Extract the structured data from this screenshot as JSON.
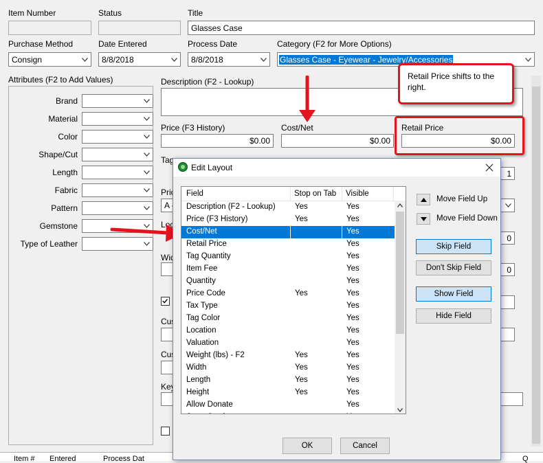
{
  "header_fields": {
    "item_number": {
      "label": "Item Number",
      "value": ""
    },
    "status": {
      "label": "Status",
      "value": ""
    },
    "title": {
      "label": "Title",
      "value": "Glasses Case"
    },
    "purchase_method": {
      "label": "Purchase Method",
      "value": "Consign"
    },
    "date_entered": {
      "label": "Date Entered",
      "value": "8/8/2018"
    },
    "process_date": {
      "label": "Process Date",
      "value": "8/8/2018"
    },
    "category": {
      "label": "Category (F2 for More Options)",
      "value": "Glasses Case - Eyewear - Jewelry/Accessories"
    }
  },
  "attributes": {
    "title": "Attributes (F2 to Add Values)",
    "items": [
      {
        "label": "Brand"
      },
      {
        "label": "Material"
      },
      {
        "label": "Color"
      },
      {
        "label": "Shape/Cut"
      },
      {
        "label": "Length"
      },
      {
        "label": "Fabric"
      },
      {
        "label": "Pattern"
      },
      {
        "label": "Gemstone"
      },
      {
        "label": "Type of Leather"
      }
    ]
  },
  "main_form": {
    "description_label": "Description (F2 - Lookup)",
    "price_label": "Price (F3 History)",
    "price_value": "$0.00",
    "cost_label": "Cost/Net",
    "cost_value": "$0.00",
    "retail_label": "Retail Price",
    "retail_value": "$0.00",
    "tag_label_fragment": "Tag",
    "price_code_label_fragment": "Pric",
    "price_code_value_fragment": "A -",
    "location_label_fragment": "Loca",
    "width_label_fragment": "Wid",
    "custom1_label_fragment": "Cus",
    "custom2_label_fragment": "Cus",
    "keywords_label_fragment": "Key",
    "qty_value": "1",
    "field_a_value": "0",
    "field_b_value": "0",
    "bottom_left_fragments": [
      "Item #",
      "Entered",
      "Process Dat"
    ],
    "bottom_right_fragment": "Q"
  },
  "callout": {
    "text": "Retail Price shifts to the right.",
    "accent": "#e3141e"
  },
  "dialog": {
    "title": "Edit Layout",
    "columns": [
      "Field",
      "Stop on Tab",
      "Visible"
    ],
    "rows": [
      {
        "field": "Description (F2 - Lookup)",
        "stop": "Yes",
        "visible": "Yes"
      },
      {
        "field": "Price (F3 History)",
        "stop": "Yes",
        "visible": "Yes"
      },
      {
        "field": "Cost/Net",
        "stop": "",
        "visible": "Yes",
        "selected": true
      },
      {
        "field": "Retail Price",
        "stop": "",
        "visible": "Yes"
      },
      {
        "field": "Tag Quantity",
        "stop": "",
        "visible": "Yes"
      },
      {
        "field": "Item Fee",
        "stop": "",
        "visible": "Yes"
      },
      {
        "field": "Quantity",
        "stop": "",
        "visible": "Yes"
      },
      {
        "field": "Price Code",
        "stop": "Yes",
        "visible": "Yes"
      },
      {
        "field": "Tax Type",
        "stop": "",
        "visible": "Yes"
      },
      {
        "field": "Tag Color",
        "stop": "",
        "visible": "Yes"
      },
      {
        "field": "Location",
        "stop": "",
        "visible": "Yes"
      },
      {
        "field": "Valuation",
        "stop": "",
        "visible": "Yes"
      },
      {
        "field": "Weight (lbs) - F2",
        "stop": "Yes",
        "visible": "Yes"
      },
      {
        "field": "Width",
        "stop": "Yes",
        "visible": "Yes"
      },
      {
        "field": "Length",
        "stop": "Yes",
        "visible": "Yes"
      },
      {
        "field": "Height",
        "stop": "Yes",
        "visible": "Yes"
      },
      {
        "field": "Allow Donate",
        "stop": "",
        "visible": "Yes"
      },
      {
        "field": "Store Section",
        "stop": "",
        "visible": "Yes"
      }
    ],
    "move_up_label": "Move Field Up",
    "move_down_label": "Move Field Down",
    "skip_label": "Skip Field",
    "dont_skip_label": "Don't Skip Field",
    "show_label": "Show Field",
    "hide_label": "Hide Field",
    "ok_label": "OK",
    "cancel_label": "Cancel",
    "selection_color": "#0078d7"
  }
}
